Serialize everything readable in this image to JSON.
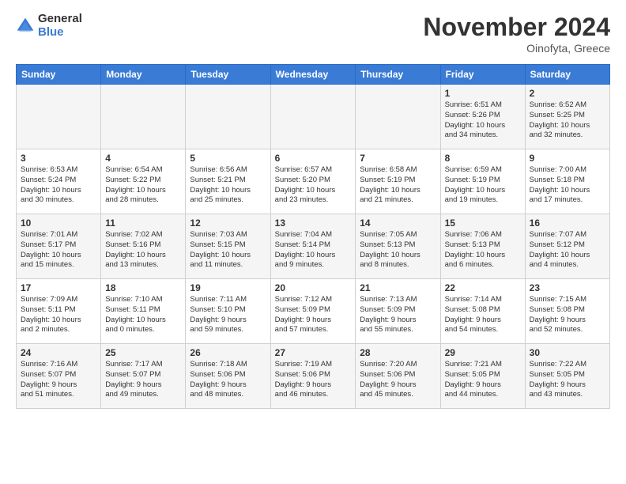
{
  "logo": {
    "general": "General",
    "blue": "Blue"
  },
  "title": "November 2024",
  "location": "Oinofyta, Greece",
  "weekdays": [
    "Sunday",
    "Monday",
    "Tuesday",
    "Wednesday",
    "Thursday",
    "Friday",
    "Saturday"
  ],
  "weeks": [
    [
      {
        "day": "",
        "info": ""
      },
      {
        "day": "",
        "info": ""
      },
      {
        "day": "",
        "info": ""
      },
      {
        "day": "",
        "info": ""
      },
      {
        "day": "",
        "info": ""
      },
      {
        "day": "1",
        "info": "Sunrise: 6:51 AM\nSunset: 5:26 PM\nDaylight: 10 hours\nand 34 minutes."
      },
      {
        "day": "2",
        "info": "Sunrise: 6:52 AM\nSunset: 5:25 PM\nDaylight: 10 hours\nand 32 minutes."
      }
    ],
    [
      {
        "day": "3",
        "info": "Sunrise: 6:53 AM\nSunset: 5:24 PM\nDaylight: 10 hours\nand 30 minutes."
      },
      {
        "day": "4",
        "info": "Sunrise: 6:54 AM\nSunset: 5:22 PM\nDaylight: 10 hours\nand 28 minutes."
      },
      {
        "day": "5",
        "info": "Sunrise: 6:56 AM\nSunset: 5:21 PM\nDaylight: 10 hours\nand 25 minutes."
      },
      {
        "day": "6",
        "info": "Sunrise: 6:57 AM\nSunset: 5:20 PM\nDaylight: 10 hours\nand 23 minutes."
      },
      {
        "day": "7",
        "info": "Sunrise: 6:58 AM\nSunset: 5:19 PM\nDaylight: 10 hours\nand 21 minutes."
      },
      {
        "day": "8",
        "info": "Sunrise: 6:59 AM\nSunset: 5:19 PM\nDaylight: 10 hours\nand 19 minutes."
      },
      {
        "day": "9",
        "info": "Sunrise: 7:00 AM\nSunset: 5:18 PM\nDaylight: 10 hours\nand 17 minutes."
      }
    ],
    [
      {
        "day": "10",
        "info": "Sunrise: 7:01 AM\nSunset: 5:17 PM\nDaylight: 10 hours\nand 15 minutes."
      },
      {
        "day": "11",
        "info": "Sunrise: 7:02 AM\nSunset: 5:16 PM\nDaylight: 10 hours\nand 13 minutes."
      },
      {
        "day": "12",
        "info": "Sunrise: 7:03 AM\nSunset: 5:15 PM\nDaylight: 10 hours\nand 11 minutes."
      },
      {
        "day": "13",
        "info": "Sunrise: 7:04 AM\nSunset: 5:14 PM\nDaylight: 10 hours\nand 9 minutes."
      },
      {
        "day": "14",
        "info": "Sunrise: 7:05 AM\nSunset: 5:13 PM\nDaylight: 10 hours\nand 8 minutes."
      },
      {
        "day": "15",
        "info": "Sunrise: 7:06 AM\nSunset: 5:13 PM\nDaylight: 10 hours\nand 6 minutes."
      },
      {
        "day": "16",
        "info": "Sunrise: 7:07 AM\nSunset: 5:12 PM\nDaylight: 10 hours\nand 4 minutes."
      }
    ],
    [
      {
        "day": "17",
        "info": "Sunrise: 7:09 AM\nSunset: 5:11 PM\nDaylight: 10 hours\nand 2 minutes."
      },
      {
        "day": "18",
        "info": "Sunrise: 7:10 AM\nSunset: 5:11 PM\nDaylight: 10 hours\nand 0 minutes."
      },
      {
        "day": "19",
        "info": "Sunrise: 7:11 AM\nSunset: 5:10 PM\nDaylight: 9 hours\nand 59 minutes."
      },
      {
        "day": "20",
        "info": "Sunrise: 7:12 AM\nSunset: 5:09 PM\nDaylight: 9 hours\nand 57 minutes."
      },
      {
        "day": "21",
        "info": "Sunrise: 7:13 AM\nSunset: 5:09 PM\nDaylight: 9 hours\nand 55 minutes."
      },
      {
        "day": "22",
        "info": "Sunrise: 7:14 AM\nSunset: 5:08 PM\nDaylight: 9 hours\nand 54 minutes."
      },
      {
        "day": "23",
        "info": "Sunrise: 7:15 AM\nSunset: 5:08 PM\nDaylight: 9 hours\nand 52 minutes."
      }
    ],
    [
      {
        "day": "24",
        "info": "Sunrise: 7:16 AM\nSunset: 5:07 PM\nDaylight: 9 hours\nand 51 minutes."
      },
      {
        "day": "25",
        "info": "Sunrise: 7:17 AM\nSunset: 5:07 PM\nDaylight: 9 hours\nand 49 minutes."
      },
      {
        "day": "26",
        "info": "Sunrise: 7:18 AM\nSunset: 5:06 PM\nDaylight: 9 hours\nand 48 minutes."
      },
      {
        "day": "27",
        "info": "Sunrise: 7:19 AM\nSunset: 5:06 PM\nDaylight: 9 hours\nand 46 minutes."
      },
      {
        "day": "28",
        "info": "Sunrise: 7:20 AM\nSunset: 5:06 PM\nDaylight: 9 hours\nand 45 minutes."
      },
      {
        "day": "29",
        "info": "Sunrise: 7:21 AM\nSunset: 5:05 PM\nDaylight: 9 hours\nand 44 minutes."
      },
      {
        "day": "30",
        "info": "Sunrise: 7:22 AM\nSunset: 5:05 PM\nDaylight: 9 hours\nand 43 minutes."
      }
    ]
  ]
}
